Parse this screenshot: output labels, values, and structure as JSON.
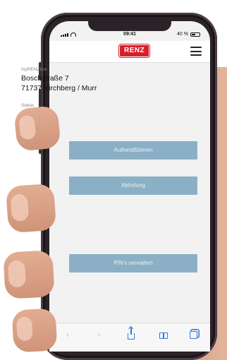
{
  "status_bar": {
    "time": "09:41",
    "battery_text": "40 %",
    "icons": [
      "signal-icon",
      "wifi-icon",
      "battery-icon"
    ]
  },
  "header": {
    "logo_text": "RENZ",
    "menu_icon": "hamburger-menu-icon"
  },
  "box": {
    "label": "myRENZbox",
    "street": "Boschstraße 7",
    "city": "71737 Kirchberg / Murr"
  },
  "status": {
    "label": "Status",
    "value": "Bereit"
  },
  "actions": {
    "authenticate": "Authentifizieren",
    "pickup": "Abholung",
    "manage_pins": "PIN's verwalten"
  },
  "toolbar": {
    "back_icon": "chevron-left-icon",
    "forward_icon": "chevron-right-icon",
    "share_icon": "share-icon",
    "bookmarks_icon": "book-icon",
    "tabs_icon": "tabs-icon"
  },
  "colors": {
    "brand_red": "#d6202a",
    "button_blue": "#8bb0c6",
    "screen_bg": "#f2f2f2",
    "toolbar_blue": "#2f7ad8"
  }
}
